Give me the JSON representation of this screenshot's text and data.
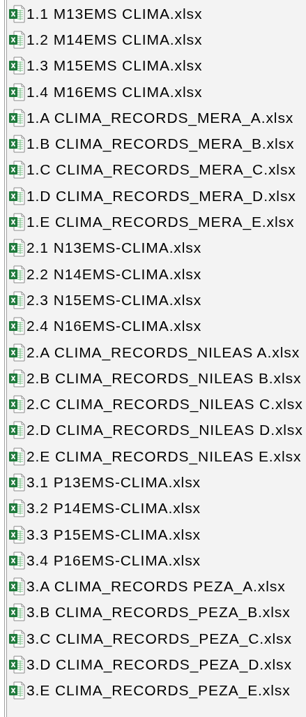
{
  "files": [
    {
      "name": "1.1 M13EMS CLIMA.xlsx"
    },
    {
      "name": "1.2 M14EMS CLIMA.xlsx"
    },
    {
      "name": "1.3 M15EMS CLIMA.xlsx"
    },
    {
      "name": "1.4 M16EMS CLIMA.xlsx"
    },
    {
      "name": "1.A CLIMA_RECORDS_MERA_A.xlsx"
    },
    {
      "name": "1.B CLIMA_RECORDS_MERA_B.xlsx"
    },
    {
      "name": "1.C CLIMA_RECORDS_MERA_C.xlsx"
    },
    {
      "name": "1.D CLIMA_RECORDS_MERA_D.xlsx"
    },
    {
      "name": "1.E CLIMA_RECORDS_MERA_E.xlsx"
    },
    {
      "name": "2.1 N13EMS-CLIMA.xlsx"
    },
    {
      "name": "2.2 N14EMS-CLIMA.xlsx"
    },
    {
      "name": "2.3 N15EMS-CLIMA.xlsx"
    },
    {
      "name": "2.4 N16EMS-CLIMA.xlsx"
    },
    {
      "name": "2.A CLIMA_RECORDS_NILEAS A.xlsx"
    },
    {
      "name": "2.B CLIMA_RECORDS_NILEAS B.xlsx"
    },
    {
      "name": "2.C CLIMA_RECORDS_NILEAS C.xlsx"
    },
    {
      "name": "2.D CLIMA_RECORDS_NILEAS D.xlsx"
    },
    {
      "name": "2.E CLIMA_RECORDS_NILEAS E.xlsx"
    },
    {
      "name": "3.1 P13EMS-CLIMA.xlsx"
    },
    {
      "name": "3.2 P14EMS-CLIMA.xlsx"
    },
    {
      "name": "3.3 P15EMS-CLIMA.xlsx"
    },
    {
      "name": "3.4 P16EMS-CLIMA.xlsx"
    },
    {
      "name": "3.A CLIMA_RECORDS PEZA_A.xlsx"
    },
    {
      "name": "3.B CLIMA_RECORDS_PEZA_B.xlsx"
    },
    {
      "name": "3.C CLIMA_RECORDS_PEZA_C.xlsx"
    },
    {
      "name": "3.D CLIMA_RECORDS_PEZA_D.xlsx"
    },
    {
      "name": "3.E CLIMA_RECORDS_PEZA_E.xlsx"
    }
  ]
}
